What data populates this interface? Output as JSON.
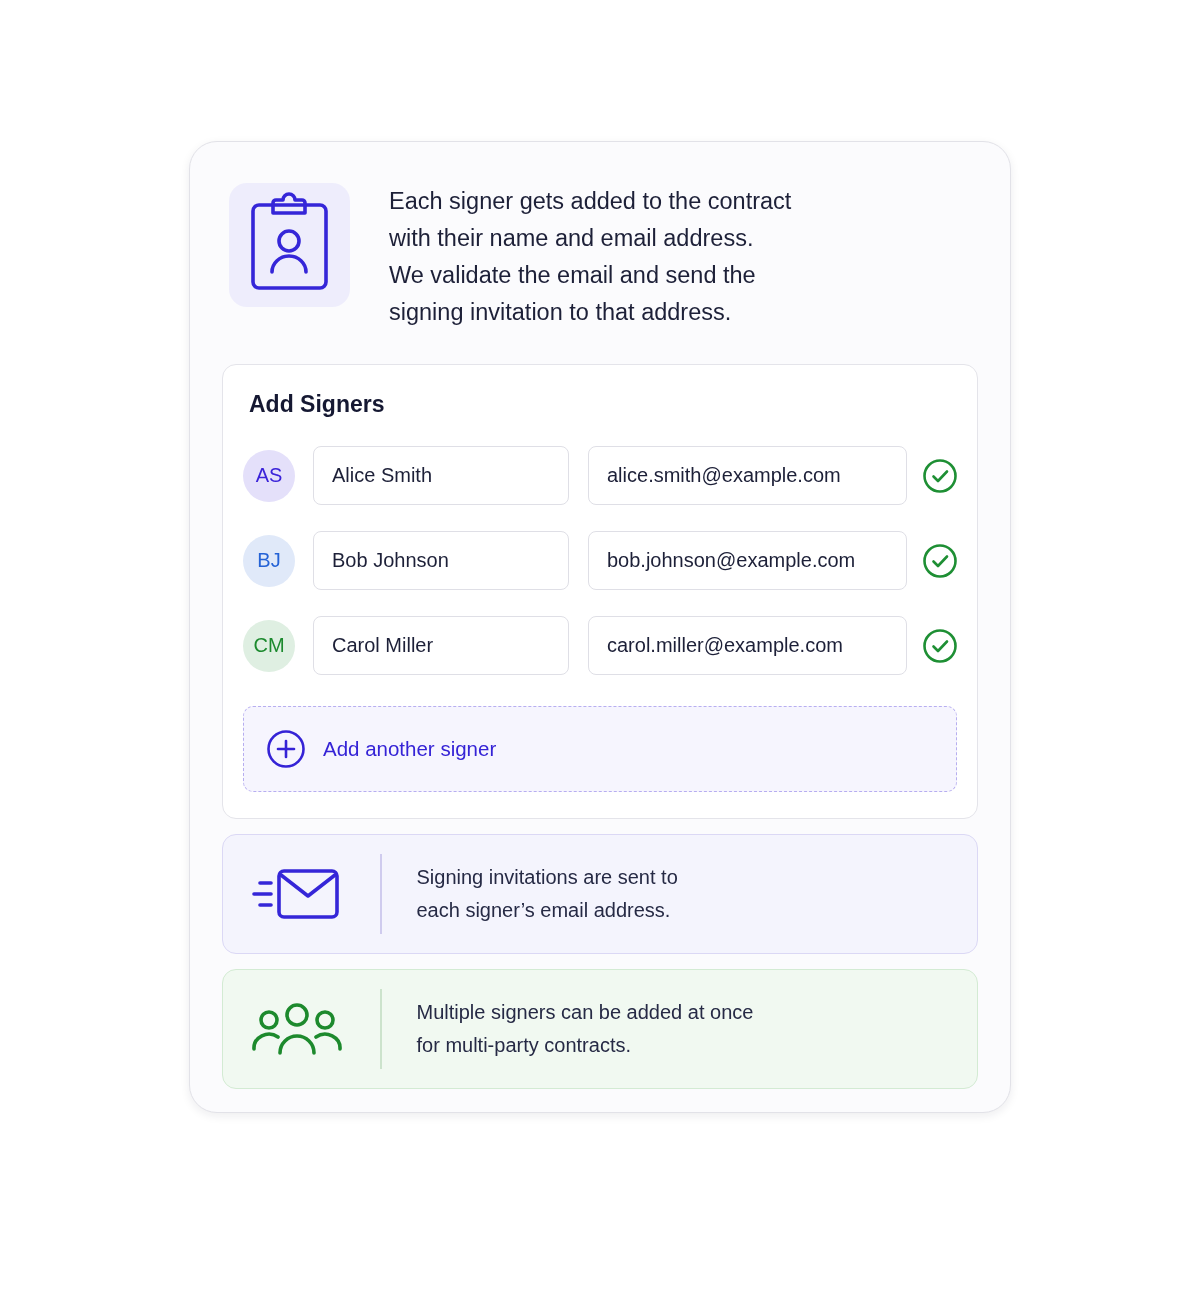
{
  "intro": {
    "text": "Each signer gets added to the contract\nwith their name and email address.\nWe validate the email and send the\nsigning invitation to that address."
  },
  "signers_panel": {
    "title": "Add Signers",
    "signers": [
      {
        "initials": "AS",
        "color": "#3b23d9",
        "name": "Alice Smith",
        "email": "alice.smith@example.com",
        "valid": true
      },
      {
        "initials": "BJ",
        "color": "#2563d6",
        "name": "Bob Johnson",
        "email": "bob.johnson@example.com",
        "valid": true
      },
      {
        "initials": "CM",
        "color": "#1c8a2e",
        "name": "Carol Miller",
        "email": "carol.miller@example.com",
        "valid": true
      }
    ],
    "add_button": {
      "label": "Add another signer"
    }
  },
  "notes": [
    {
      "kind": "email",
      "text": "Signing invitations are sent to\neach signer’s email address."
    },
    {
      "kind": "group",
      "text": "Multiple signers can be added at once\nfor multi-party contracts."
    }
  ]
}
